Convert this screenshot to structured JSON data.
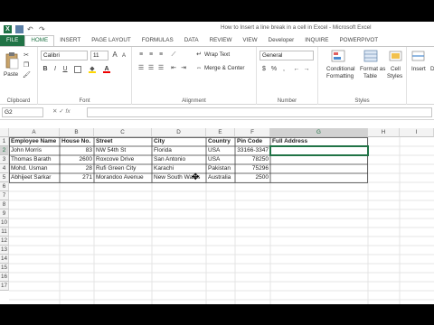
{
  "window": {
    "title": "How to Insert a line break in a cell in Excel - Microsoft Excel"
  },
  "qat": {
    "logo_letter": "X"
  },
  "tabs": [
    "FILE",
    "HOME",
    "INSERT",
    "PAGE LAYOUT",
    "FORMULAS",
    "DATA",
    "REVIEW",
    "VIEW",
    "Developer",
    "INQUIRE",
    "POWERPIVOT"
  ],
  "ribbon": {
    "clipboard": {
      "paste_label": "Paste",
      "group_label": "Clipboard"
    },
    "font": {
      "font_name": "Calibri",
      "font_size": "11",
      "bold": "B",
      "italic": "I",
      "underline": "U",
      "grow": "A",
      "shrink": "A",
      "group_label": "Font"
    },
    "alignment": {
      "wrap_text": "Wrap Text",
      "merge_center": "Merge & Center",
      "group_label": "Alignment"
    },
    "number": {
      "format": "General",
      "currency": "$",
      "percent": "%",
      "comma": ",",
      "group_label": "Number"
    },
    "styles": {
      "conditional": "Conditional",
      "conditional2": "Formatting",
      "format_as": "Format as",
      "format_as2": "Table",
      "cell": "Cell",
      "cell2": "Styles",
      "group_label": "Styles"
    },
    "cells": {
      "insert": "Insert",
      "delete": "D"
    }
  },
  "formula_bar": {
    "name_box": "G2",
    "content": ""
  },
  "columns": [
    "A",
    "B",
    "C",
    "D",
    "E",
    "F",
    "G",
    "H",
    "I"
  ],
  "rows": [
    "1",
    "2",
    "3",
    "4",
    "5",
    "6",
    "7",
    "8",
    "9",
    "10",
    "11",
    "12",
    "13",
    "14",
    "15",
    "16",
    "17"
  ],
  "table": {
    "headers": [
      "Employee Name",
      "House No.",
      "Street",
      "City",
      "Country",
      "Pin Code",
      "Full Address"
    ],
    "rows": [
      [
        "John Morris",
        "83",
        "NW 54th St",
        "Florida",
        "USA",
        "33166-3347",
        ""
      ],
      [
        "Thomas Barath",
        "2600",
        "Roxcove Drive",
        "San Antonio",
        "USA",
        "78250",
        ""
      ],
      [
        "Mohd. Usman",
        "28",
        "Rufi Green City",
        "Karachi",
        "Pakistan",
        "75296",
        ""
      ],
      [
        "Abhijeet Sarkar",
        "271",
        "Morandoo Avenue",
        "New South Wales",
        "Australia",
        "2500",
        ""
      ]
    ]
  },
  "selected_cell": "G2",
  "colors": {
    "accent": "#217346",
    "header_bg": "#f3f3f3"
  }
}
